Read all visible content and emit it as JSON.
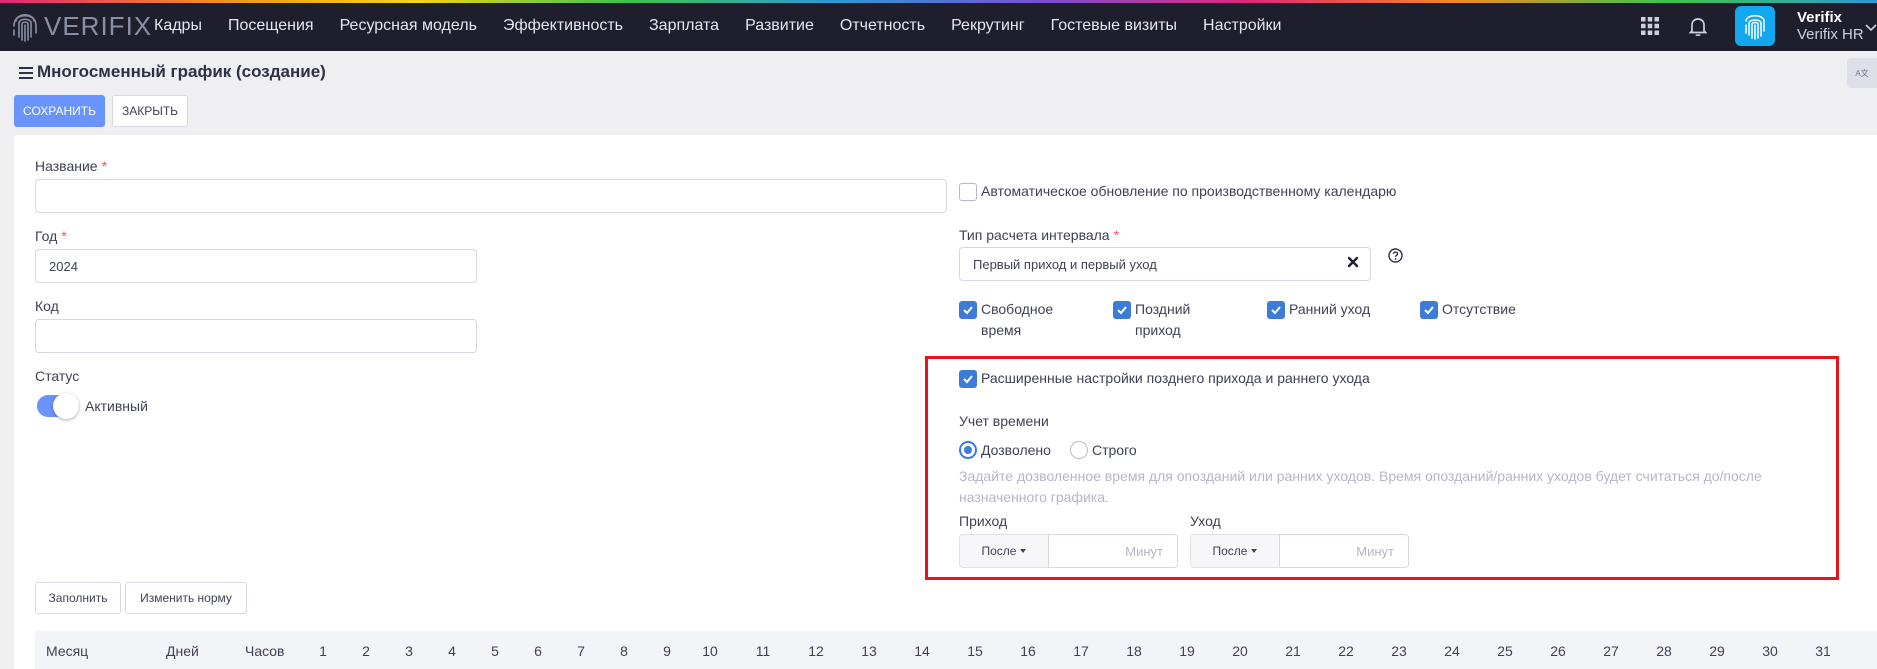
{
  "app": {
    "logo_text": "VERIFIX"
  },
  "nav": {
    "items": [
      "Кадры",
      "Посещения",
      "Ресурсная модель",
      "Эффективность",
      "Зарплата",
      "Развитие",
      "Отчетность",
      "Рекрутинг",
      "Гостевые визиты",
      "Настройки"
    ]
  },
  "user": {
    "name": "Verifix",
    "org": "Verifix HR"
  },
  "page": {
    "title": "Многосменный график (создание)",
    "translate_badge": "A文"
  },
  "toolbar": {
    "save_label": "СОХРАНИТЬ",
    "close_label": "ЗАКРЫТЬ"
  },
  "form": {
    "name_label": "Название",
    "name_value": "",
    "year_label": "Год",
    "year_value": "2024",
    "code_label": "Код",
    "code_value": "",
    "status_label": "Статус",
    "status_value": "Активный",
    "status_on": true,
    "required_mark": "*"
  },
  "right": {
    "auto_update_label": "Автоматическое обновление по производственному календарю",
    "auto_update_checked": false,
    "interval_label": "Тип расчета интервала",
    "interval_value": "Первый приход и первый уход",
    "checks": [
      {
        "label_line1": "Свободное",
        "label_line2": "время",
        "checked": true
      },
      {
        "label_line1": "Поздний",
        "label_line2": "приход",
        "checked": true
      },
      {
        "label_line1": "Ранний уход",
        "label_line2": "",
        "checked": true
      },
      {
        "label_line1": "Отсутствие",
        "label_line2": "",
        "checked": true
      }
    ]
  },
  "advanced": {
    "toggle_label": "Расширенные настройки позднего прихода и раннего ухода",
    "checked": true,
    "time_label": "Учет времени",
    "options": [
      {
        "label": "Дозволено",
        "selected": true
      },
      {
        "label": "Строго",
        "selected": false
      }
    ],
    "hint": "Задайте дозволенное время для опозданий или ранних уходов. Время опозданий/ранних уходов будет считаться до/после назначенного графика.",
    "arrival_label": "Приход",
    "departure_label": "Уход",
    "arrival_mode": "После",
    "departure_mode": "После",
    "minutes_placeholder": "Минут"
  },
  "actions": {
    "fill_label": "Заполнить",
    "change_norm_label": "Изменить норму"
  },
  "table": {
    "headers": {
      "month": "Месяц",
      "days": "Дней",
      "hours": "Часов"
    },
    "days": [
      "1",
      "2",
      "3",
      "4",
      "5",
      "6",
      "7",
      "8",
      "9",
      "10",
      "11",
      "12",
      "13",
      "14",
      "15",
      "16",
      "17",
      "18",
      "19",
      "20",
      "21",
      "22",
      "23",
      "24",
      "25",
      "26",
      "27",
      "28",
      "29",
      "30",
      "31"
    ]
  },
  "colors": {
    "accent": "#6993ff",
    "checkbox": "#3c7bd8",
    "highlight": "#e3151a",
    "topbar": "#1e1e2d"
  }
}
